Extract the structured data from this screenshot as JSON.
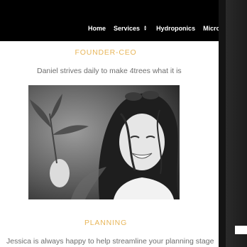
{
  "nav": {
    "items": [
      {
        "label": "Home"
      },
      {
        "label": "Services",
        "has_dropdown": true
      },
      {
        "label": "Hydroponics"
      },
      {
        "label": "Micro C"
      }
    ]
  },
  "team": [
    {
      "role": "FOUNDER-CEO",
      "description": "Daniel strives daily to make 4trees what it is",
      "photo_icon": "portrait-photo"
    },
    {
      "role": "PLANNING",
      "description": "Jessica is always happy to help streamline your planning stage"
    }
  ],
  "colors": {
    "header_bg": "#000000",
    "accent": "#e8b65a",
    "body_text": "#6e6e6e"
  }
}
